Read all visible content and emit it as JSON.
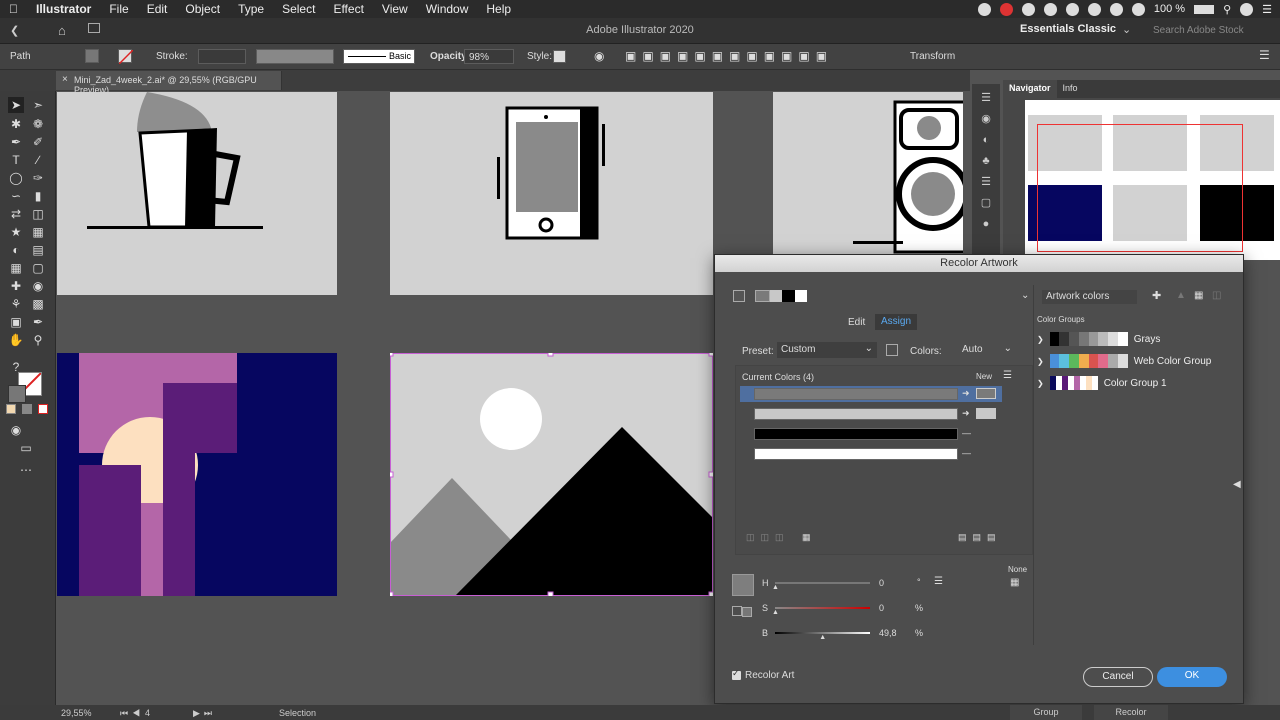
{
  "menubar": {
    "app": "Illustrator",
    "items": [
      "File",
      "Edit",
      "Object",
      "Type",
      "Select",
      "Effect",
      "View",
      "Window",
      "Help"
    ],
    "battery": "100 %"
  },
  "appbar": {
    "title": "Adobe Illustrator 2020",
    "workspace": "Essentials Classic",
    "search_placeholder": "Search Adobe Stock"
  },
  "controlbar": {
    "selection_type": "Path",
    "stroke_label": "Stroke:",
    "brush_label": "Basic",
    "opacity_label": "Opacity:",
    "opacity_value": "98%",
    "style_label": "Style:",
    "transform_label": "Transform"
  },
  "document": {
    "tab_title": "Mini_Zad_4week_2.ai* @ 29,55% (RGB/GPU Preview)"
  },
  "navigator": {
    "tabs": [
      "Navigator",
      "Info"
    ]
  },
  "recolor": {
    "title": "Recolor Artwork",
    "mode_tabs": [
      "Edit",
      "Assign"
    ],
    "preset_label": "Preset:",
    "preset_value": "Custom",
    "colors_label": "Colors:",
    "colors_value": "Auto",
    "current_colors_label": "Current Colors (4)",
    "new_label": "New",
    "current_colors": [
      "#7a7a7a",
      "#c8c8c8",
      "#000000",
      "#ffffff"
    ],
    "artwork_colors_label": "Artwork colors",
    "color_groups_label": "Color Groups",
    "color_groups": [
      {
        "name": "Grays",
        "swatches": [
          "#000000",
          "#333333",
          "#555555",
          "#777777",
          "#999999",
          "#bbbbbb",
          "#dddddd",
          "#ffffff"
        ]
      },
      {
        "name": "Web Color Group",
        "swatches": [
          "#4a90d9",
          "#5bc0de",
          "#5cb85c",
          "#f0ad4e",
          "#d9534f",
          "#e06b8b",
          "#aaaaaa",
          "#dddddd"
        ]
      },
      {
        "name": "Color Group 1",
        "swatches": [
          "#0a0a5a",
          "#ffffff",
          "#5a1a78",
          "#ffffff",
          "#b466a8",
          "#ffffff",
          "#fde0c0",
          "#ffffff"
        ]
      }
    ],
    "h_label": "H",
    "h_value": "0",
    "h_unit": "°",
    "s_label": "S",
    "s_value": "0",
    "s_unit": "%",
    "b_label": "B",
    "b_value": "49,8",
    "b_unit": "%",
    "b_level": 0.498,
    "none_label": "None",
    "recolor_art_label": "Recolor Art",
    "cancel_label": "Cancel",
    "ok_label": "OK"
  },
  "statusbar": {
    "zoom": "29,55%",
    "artboard_num": "4",
    "tool": "Selection"
  },
  "bottompanel": {
    "tabs": [
      "Group",
      "Recolor"
    ]
  },
  "colors": {
    "accent": "#3d8fe0",
    "selection": "#c75fd4",
    "navy": "#060660",
    "purple": "#5b1d78",
    "pink": "#b466a8",
    "peach": "#fde0c0"
  }
}
